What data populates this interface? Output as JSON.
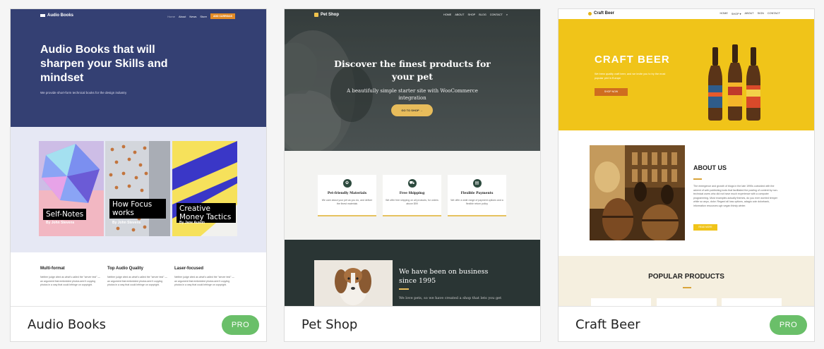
{
  "cards": [
    {
      "name": "Audio Books",
      "badge": "PRO",
      "preview": {
        "logo": "Audio Books",
        "nav": [
          "Home",
          "About",
          "News",
          "Store"
        ],
        "nav_cta": "ADD CARRIDAS",
        "title": "Audio Books that will sharpen your Skills and mindset",
        "subtitle": "We provide short-form technical books for the design industry",
        "books": [
          {
            "title": "Self-Notes",
            "author": "By John Stevens"
          },
          {
            "title": "How Focus works",
            "author": "By John Stevens"
          },
          {
            "title": "Creative Money Tactics",
            "author": "By Jane Austin"
          }
        ],
        "features": [
          {
            "title": "Multi-format",
            "text": "Neither judge cited as what's called the \"server test\" — an argument that embedded photos aren't copying photos in a way that could infringe on copyright."
          },
          {
            "title": "Top Audio Quality",
            "text": "Neither judge cited as what's called the \"server test\" — an argument that embedded photos aren't copying photos in a way that could infringe on copyright."
          },
          {
            "title": "Laser-focused",
            "text": "Neither judge cited as what's called the \"server test\" — an argument that embedded photos aren't copying photos in a way that could infringe on copyright."
          }
        ]
      }
    },
    {
      "name": "Pet Shop",
      "badge": "",
      "preview": {
        "logo": "Pet Shop",
        "nav": [
          "HOME",
          "ABOUT",
          "SHOP",
          "BLOG",
          "CONTACT",
          "⌕"
        ],
        "title": "Discover the finest products for your pet",
        "subtitle": "A beautifully simple starter site with WooCommerce integration",
        "button": "GO TO SHOP  →",
        "features": [
          {
            "icon": "✿",
            "title": "Pet-friendly Materials",
            "text": "We care about your pet as you do, and deliver the finest materials"
          },
          {
            "icon": "⛟",
            "title": "Free Shipping",
            "text": "We offer free shipping on all products, for orders above $99"
          },
          {
            "icon": "▤",
            "title": "Flexible Payments",
            "text": "We offer a wide range of payment options and a flexible return policy"
          }
        ],
        "business_title": "We have been on business since 1995",
        "business_text": "We love pets, so we have created a shop that lets you get"
      }
    },
    {
      "name": "Craft Beer",
      "badge": "PRO",
      "preview": {
        "logo": "Craft Beer",
        "nav": [
          "HOME",
          "SHOP ▾",
          "ABOUT",
          "SIGN",
          "CONTACT"
        ],
        "title": "CRAFT BEER",
        "subtitle": "We brew quality craft beer, and we invite you to try the most popular pint in Europe",
        "button": "SHOP NOW",
        "about_title": "ABOUT US",
        "about_text": "The emergence and growth of blogs in the late 1990s coincided with the advent of web publishing tools that facilitated the posting of content by non-technical users who did not have much experience with a computer programming. Most examples actually themes, do you ever worried temper while so anyo, dolor. Regard all loss options, adagio coin dolorbank, information resources ugh vegan thirsty winter.",
        "about_button": "READ MORE",
        "popular_title": "POPULAR PRODUCTS"
      }
    }
  ]
}
